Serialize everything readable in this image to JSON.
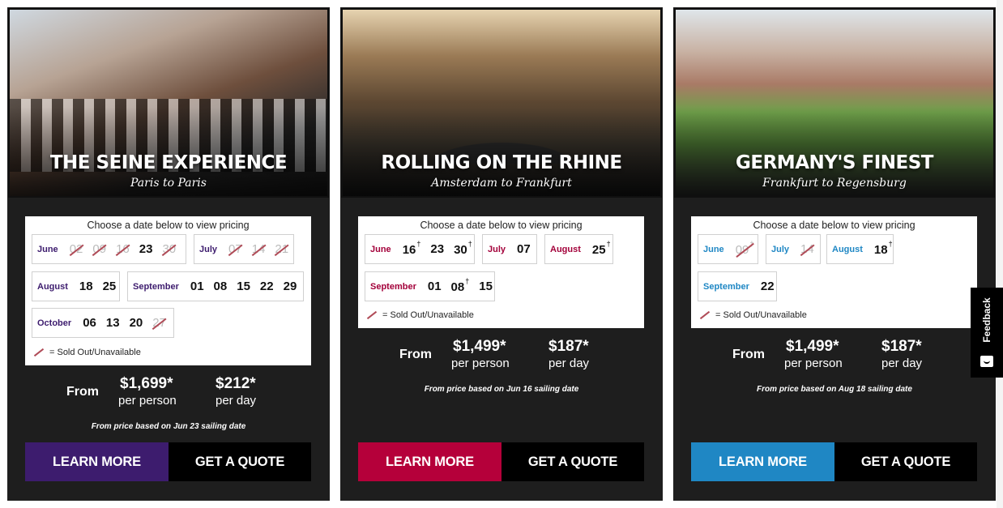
{
  "legend_text": "= Sold Out/Unavailable",
  "prompt": "Choose a date below to view pricing",
  "from_label": "From",
  "per_person_label": "per person",
  "per_day_label": "per day",
  "feedback_label": "Feedback",
  "cards": [
    {
      "title": "THE SEINE EXPERIENCE",
      "subtitle": "Paris to Paris",
      "accent": "#3d1c6e",
      "month_color": "#3d1c6e",
      "months": [
        {
          "name": "June",
          "days": [
            {
              "d": "02",
              "sold": true
            },
            {
              "d": "09",
              "sold": true
            },
            {
              "d": "16",
              "sold": true
            },
            {
              "d": "23",
              "sold": false
            },
            {
              "d": "30",
              "sold": true
            }
          ]
        },
        {
          "name": "July",
          "days": [
            {
              "d": "07",
              "sold": true
            },
            {
              "d": "14",
              "sold": true
            },
            {
              "d": "21",
              "sold": true
            }
          ]
        },
        {
          "name": "August",
          "days": [
            {
              "d": "18",
              "sold": false
            },
            {
              "d": "25",
              "sold": false
            }
          ]
        },
        {
          "name": "September",
          "days": [
            {
              "d": "01",
              "sold": false
            },
            {
              "d": "08",
              "sold": false
            },
            {
              "d": "15",
              "sold": false
            },
            {
              "d": "22",
              "sold": false
            },
            {
              "d": "29",
              "sold": false
            }
          ]
        },
        {
          "name": "October",
          "days": [
            {
              "d": "06",
              "sold": false
            },
            {
              "d": "13",
              "sold": false
            },
            {
              "d": "20",
              "sold": false
            },
            {
              "d": "27",
              "sold": true
            }
          ]
        }
      ],
      "price_per_person": "$1,699*",
      "price_per_day": "$212*",
      "note": "From price based on Jun 23 sailing date",
      "learn_more": "LEARN MORE",
      "get_quote": "GET A QUOTE"
    },
    {
      "title": "ROLLING ON THE RHINE",
      "subtitle": "Amsterdam to Frankfurt",
      "accent": "#b5003a",
      "month_color": "#a3003a",
      "months": [
        {
          "name": "June",
          "days": [
            {
              "d": "16",
              "sold": false,
              "mark": "†"
            },
            {
              "d": "23",
              "sold": false
            },
            {
              "d": "30",
              "sold": false,
              "mark": "†"
            }
          ]
        },
        {
          "name": "July",
          "days": [
            {
              "d": "07",
              "sold": false
            }
          ]
        },
        {
          "name": "August",
          "days": [
            {
              "d": "25",
              "sold": false,
              "mark": "†"
            }
          ]
        },
        {
          "name": "September",
          "days": [
            {
              "d": "01",
              "sold": false
            },
            {
              "d": "08",
              "sold": false,
              "mark": "†"
            },
            {
              "d": "15",
              "sold": false
            }
          ]
        }
      ],
      "price_per_person": "$1,499*",
      "price_per_day": "$187*",
      "note": "From price based on Jun 16 sailing date",
      "learn_more": "LEARN MORE",
      "get_quote": "GET A QUOTE"
    },
    {
      "title": "GERMANY'S FINEST",
      "subtitle": "Frankfurt to Regensburg",
      "accent": "#1f87c4",
      "month_color": "#1f87c4",
      "months": [
        {
          "name": "June",
          "days": [
            {
              "d": "09",
              "sold": true,
              "mark": "†"
            }
          ]
        },
        {
          "name": "July",
          "days": [
            {
              "d": "14",
              "sold": true
            }
          ]
        },
        {
          "name": "August",
          "days": [
            {
              "d": "18",
              "sold": false,
              "mark": "†"
            }
          ]
        },
        {
          "name": "September",
          "days": [
            {
              "d": "22",
              "sold": false
            }
          ]
        }
      ],
      "price_per_person": "$1,499*",
      "price_per_day": "$187*",
      "note": "From price based on Aug 18 sailing date",
      "learn_more": "LEARN MORE",
      "get_quote": "GET A QUOTE"
    }
  ]
}
